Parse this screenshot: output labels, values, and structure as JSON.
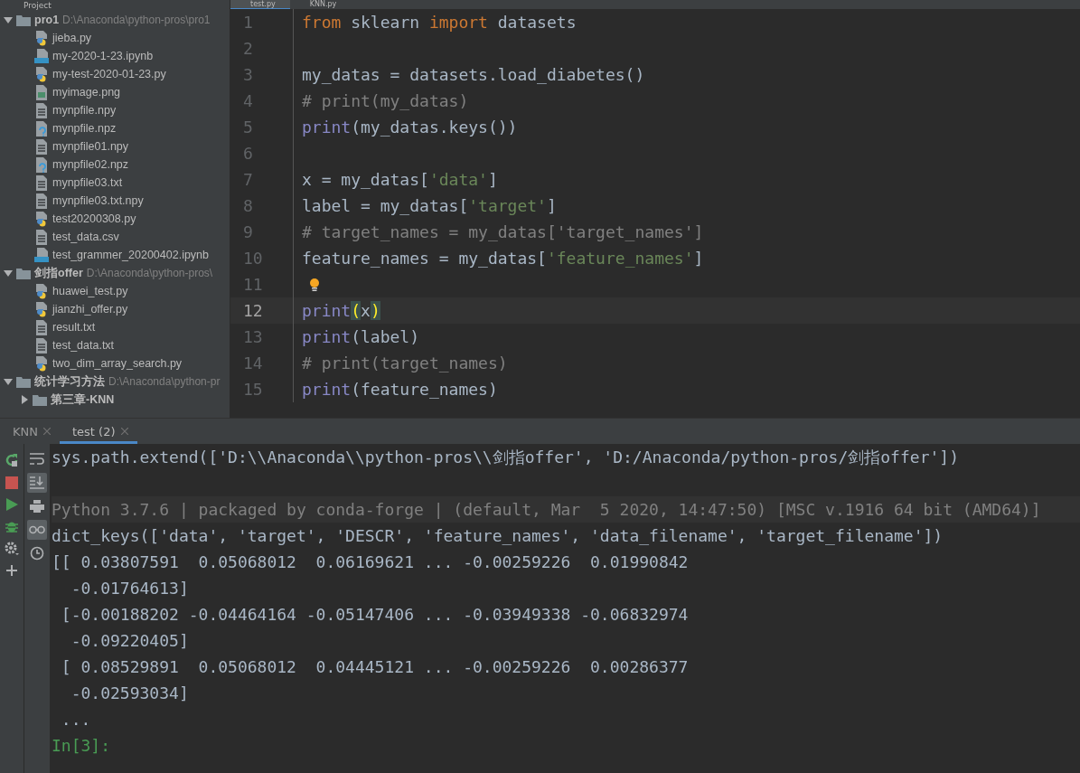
{
  "project_panel": {
    "title": "Project",
    "tree": [
      {
        "name": "pro1",
        "path": "D:\\Anaconda\\python-pros\\pro1",
        "kind": "folder",
        "expanded": true,
        "children": [
          {
            "name": "jieba.py",
            "kind": "python"
          },
          {
            "name": "my-2020-1-23.ipynb",
            "kind": "notebook"
          },
          {
            "name": "my-test-2020-01-23.py",
            "kind": "python"
          },
          {
            "name": "myimage.png",
            "kind": "image"
          },
          {
            "name": "mynpfile.npy",
            "kind": "text"
          },
          {
            "name": "mynpfile.npz",
            "kind": "unknown"
          },
          {
            "name": "mynpfile01.npy",
            "kind": "text"
          },
          {
            "name": "mynpfile02.npz",
            "kind": "unknown"
          },
          {
            "name": "mynpfile03.txt",
            "kind": "text"
          },
          {
            "name": "mynpfile03.txt.npy",
            "kind": "text"
          },
          {
            "name": "test20200308.py",
            "kind": "python"
          },
          {
            "name": "test_data.csv",
            "kind": "text"
          },
          {
            "name": "test_grammer_20200402.ipynb",
            "kind": "notebook"
          }
        ]
      },
      {
        "name": "剑指offer",
        "path": "D:\\Anaconda\\python-pros\\",
        "kind": "folder",
        "expanded": true,
        "children": [
          {
            "name": "huawei_test.py",
            "kind": "python"
          },
          {
            "name": "jianzhi_offer.py",
            "kind": "python"
          },
          {
            "name": "result.txt",
            "kind": "text"
          },
          {
            "name": "test_data.txt",
            "kind": "text"
          },
          {
            "name": "two_dim_array_search.py",
            "kind": "python"
          }
        ]
      },
      {
        "name": "统计学习方法",
        "path": "D:\\Anaconda\\python-pr",
        "kind": "folder",
        "expanded": true,
        "children": [
          {
            "name": "第三章-KNN",
            "kind": "folder",
            "expanded": false
          }
        ]
      }
    ]
  },
  "editor_tabs": [
    {
      "label": "test.py",
      "selected": true
    },
    {
      "label": "KNN.py",
      "selected": false
    }
  ],
  "code_lines": [
    {
      "number": "1",
      "current": false,
      "tokens": [
        {
          "kind": "keyword",
          "text": "from"
        },
        {
          "kind": "plain",
          "text": " sklearn "
        },
        {
          "kind": "keyword",
          "text": "import"
        },
        {
          "kind": "plain",
          "text": " datasets"
        }
      ]
    },
    {
      "number": "2",
      "current": false
    },
    {
      "number": "3",
      "current": false,
      "tokens": [
        {
          "kind": "plain",
          "text": "my_datas = datasets.load_diabetes()"
        }
      ]
    },
    {
      "number": "4",
      "current": false,
      "tokens": [
        {
          "kind": "comment",
          "text": "# print(my_datas)"
        }
      ]
    },
    {
      "number": "5",
      "current": false,
      "tokens": [
        {
          "kind": "builtin",
          "text": "print"
        },
        {
          "kind": "plain",
          "text": "(my_datas.keys())"
        }
      ]
    },
    {
      "number": "6",
      "current": false
    },
    {
      "number": "7",
      "current": false,
      "tokens": [
        {
          "kind": "plain",
          "text": "x = my_datas["
        },
        {
          "kind": "string",
          "text": "'data'"
        },
        {
          "kind": "plain",
          "text": "]"
        }
      ]
    },
    {
      "number": "8",
      "current": false,
      "tokens": [
        {
          "kind": "plain",
          "text": "label = my_datas["
        },
        {
          "kind": "string",
          "text": "'target'"
        },
        {
          "kind": "plain",
          "text": "]"
        }
      ]
    },
    {
      "number": "9",
      "current": false,
      "tokens": [
        {
          "kind": "comment",
          "text": "# target_names = my_datas['target_names']"
        }
      ]
    },
    {
      "number": "10",
      "current": false,
      "tokens": [
        {
          "kind": "plain",
          "text": "feature_names = my_datas["
        },
        {
          "kind": "string",
          "text": "'feature_names'"
        },
        {
          "kind": "plain",
          "text": "]"
        }
      ]
    },
    {
      "number": "11",
      "current": false,
      "bulb": true
    },
    {
      "number": "12",
      "current": true,
      "tokens": [
        {
          "kind": "builtin",
          "text": "print"
        },
        {
          "kind": "brace",
          "text": "("
        },
        {
          "kind": "plain",
          "text": "x"
        },
        {
          "kind": "brace",
          "text": ")"
        }
      ]
    },
    {
      "number": "13",
      "current": false,
      "tokens": [
        {
          "kind": "builtin",
          "text": "print"
        },
        {
          "kind": "plain",
          "text": "(label)"
        }
      ]
    },
    {
      "number": "14",
      "current": false,
      "tokens": [
        {
          "kind": "comment",
          "text": "# print(target_names)"
        }
      ]
    },
    {
      "number": "15",
      "current": false,
      "tokens": [
        {
          "kind": "builtin",
          "text": "print"
        },
        {
          "kind": "plain",
          "text": "(feature_names)"
        }
      ]
    }
  ],
  "run_tabs": [
    {
      "label": "KNN",
      "selected": false
    },
    {
      "label": "test (2)",
      "selected": true
    }
  ],
  "run_toolbar": [
    {
      "kind": "rerun"
    },
    {
      "kind": "stop"
    },
    {
      "kind": "run"
    },
    {
      "kind": "debug"
    },
    {
      "kind": "settings"
    },
    {
      "kind": "add"
    }
  ],
  "console_toolbar": [
    {
      "kind": "wrap",
      "on": false
    },
    {
      "kind": "scroll",
      "on": true
    },
    {
      "kind": "print",
      "on": false
    },
    {
      "kind": "glasses",
      "on": true
    },
    {
      "kind": "history",
      "on": false
    }
  ],
  "console_lines": [
    {
      "kind": "output",
      "text": "sys.path.extend(['D:\\\\Anaconda\\\\python-pros\\\\剑指offer', 'D:/Anaconda/python-pros/剑指offer'])"
    },
    {
      "kind": "blank"
    },
    {
      "kind": "banner",
      "text": "Python 3.7.6 | packaged by conda-forge | (default, Mar  5 2020, 14:47:50) [MSC v.1916 64 bit (AMD64)]"
    },
    {
      "kind": "output",
      "text": "dict_keys(['data', 'target', 'DESCR', 'feature_names', 'data_filename', 'target_filename'])"
    },
    {
      "kind": "output",
      "text": "[[ 0.03807591  0.05068012  0.06169621 ... -0.00259226  0.01990842"
    },
    {
      "kind": "output",
      "text": "  -0.01764613]"
    },
    {
      "kind": "output",
      "text": " [-0.00188202 -0.04464164 -0.05147406 ... -0.03949338 -0.06832974"
    },
    {
      "kind": "output",
      "text": "  -0.09220405]"
    },
    {
      "kind": "output",
      "text": " [ 0.08529891  0.05068012  0.04445121 ... -0.00259226  0.00286377"
    },
    {
      "kind": "output",
      "text": "  -0.02593034]"
    },
    {
      "kind": "output",
      "text": " ..."
    },
    {
      "kind": "prompt",
      "text": "In[3]:"
    }
  ]
}
